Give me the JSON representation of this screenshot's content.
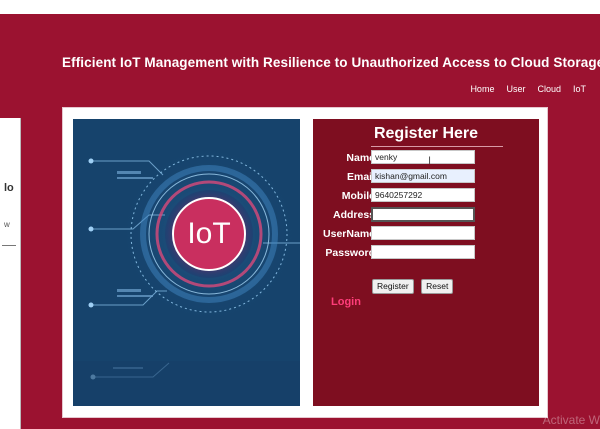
{
  "background_window": {
    "text_1": "lo",
    "text_2": "w"
  },
  "header": {
    "title": "Efficient IoT Management with Resilience to Unauthorized Access to Cloud Storage",
    "nav": [
      "Home",
      "User",
      "Cloud",
      "IoT"
    ]
  },
  "illustration": {
    "center_text": "IoT"
  },
  "form": {
    "title": "Register Here",
    "fields": [
      {
        "label": "Name",
        "value": "venky"
      },
      {
        "label": "Email",
        "value": "kishan@gmail.com"
      },
      {
        "label": "Mobile",
        "value": "9640257292"
      },
      {
        "label": "Address",
        "value": ""
      },
      {
        "label": "UserName",
        "value": ""
      },
      {
        "label": "Password",
        "value": ""
      }
    ],
    "register_button": "Register",
    "reset_button": "Reset",
    "login_link": "Login"
  },
  "os_watermark": "Activate W",
  "colors": {
    "page_bg": "#9b1230",
    "form_bg": "#7e0e20",
    "illustration_bg": "#15406a",
    "login_link": "#ff3d7a"
  }
}
